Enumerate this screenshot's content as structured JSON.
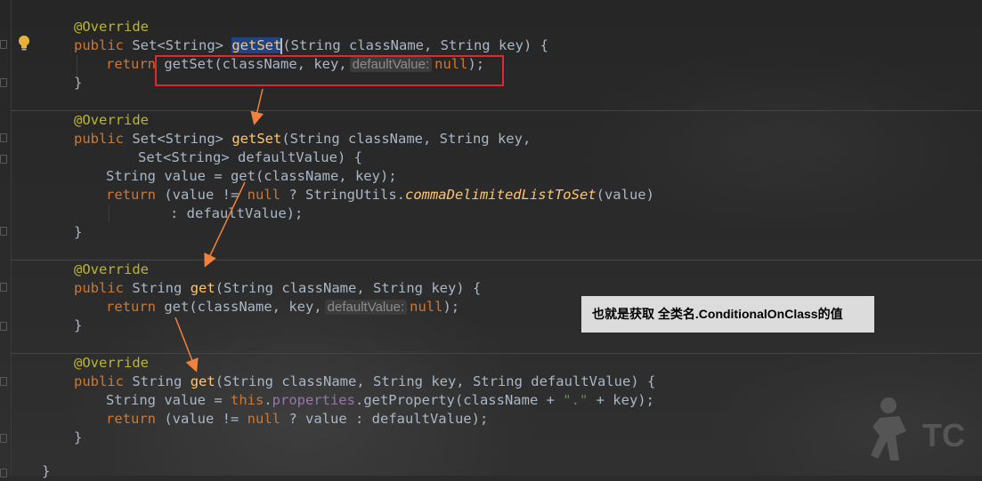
{
  "editor": {
    "blocks": [
      {
        "annotation": "@Override",
        "sig_kw": "public",
        "sig_type": "Set<String>",
        "sig_name": "getSet",
        "sig_params": "(String className, String key) {",
        "body_kw": "return",
        "body_call": "getSet(className, key,",
        "hint": "defaultValue:",
        "body_null": "null",
        "body_end": ");",
        "close": "}"
      },
      {
        "annotation": "@Override",
        "sig_kw": "public",
        "sig_type": "Set<String>",
        "sig_name": "getSet",
        "sig_params": "(String className, String key,",
        "sig2": "Set<String> defaultValue) {",
        "line1": "String value = get(className, key);",
        "ret_kw": "return",
        "ret_a": "(value != ",
        "ret_null": "null",
        "ret_b": " ? StringUtils.",
        "ret_method": "commaDelimitedListToSet",
        "ret_c": "(value)",
        "line3": ": defaultValue);",
        "close": "}"
      },
      {
        "annotation": "@Override",
        "sig_kw": "public",
        "sig_type": "String",
        "sig_name": "get",
        "sig_params": "(String className, String key) {",
        "body_kw": "return",
        "body_call": "get(className, key,",
        "hint": "defaultValue:",
        "body_null": "null",
        "body_end": ");",
        "close": "}"
      },
      {
        "annotation": "@Override",
        "sig_kw": "public",
        "sig_type": "String",
        "sig_name": "get",
        "sig_params": "(String className, String key, String defaultValue) {",
        "l1_a": "String value = ",
        "l1_this": "this",
        "l1_dot": ".",
        "l1_field": "properties",
        "l1_b": ".getProperty(className + ",
        "l1_str": "\".\"",
        "l1_c": " + key);",
        "ret_kw": "return",
        "ret_a": "(value != ",
        "ret_null": "null",
        "ret_b": " ? value : defaultValue);",
        "close": "}"
      }
    ],
    "last_close": "}"
  },
  "note": "也就是获取 全类名.ConditionalOnClass的值",
  "colors": {
    "annotation": "#bbb529",
    "keyword": "#cc7832",
    "method": "#ffc66d",
    "text": "#a9b7c6",
    "highlight_box": "#e0282d",
    "arrow": "#f0823c",
    "note_bg": "#dcdcdc"
  },
  "icons": [
    "lightbulb-icon",
    "fold-marker-icon",
    "arrow-icon",
    "watermark-logo-icon"
  ]
}
